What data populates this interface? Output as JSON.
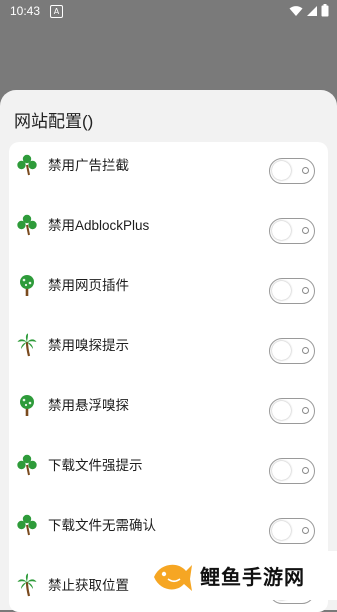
{
  "status_bar": {
    "time": "10:43",
    "notif": "A"
  },
  "sheet": {
    "title": "网站配置()"
  },
  "settings": [
    {
      "label": "禁用广告拦截",
      "icon": "clover-icon",
      "enabled": false
    },
    {
      "label": "禁用AdblockPlus",
      "icon": "clover-icon",
      "enabled": false
    },
    {
      "label": "禁用网页插件",
      "icon": "tree-icon",
      "enabled": false
    },
    {
      "label": "禁用嗅探提示",
      "icon": "palm-tree-icon",
      "enabled": false
    },
    {
      "label": "禁用悬浮嗅探",
      "icon": "tree-icon",
      "enabled": false
    },
    {
      "label": "下载文件强提示",
      "icon": "clover-icon",
      "enabled": false
    },
    {
      "label": "下载文件无需确认",
      "icon": "clover-icon",
      "enabled": false
    },
    {
      "label": "禁止获取位置",
      "icon": "palm-tree-icon",
      "enabled": false
    }
  ],
  "watermark": {
    "text": "鲤鱼手游网"
  },
  "colors": {
    "leaf": "#2e9b3a",
    "trunk": "#7a4a1e",
    "fish": "#f6a623"
  }
}
